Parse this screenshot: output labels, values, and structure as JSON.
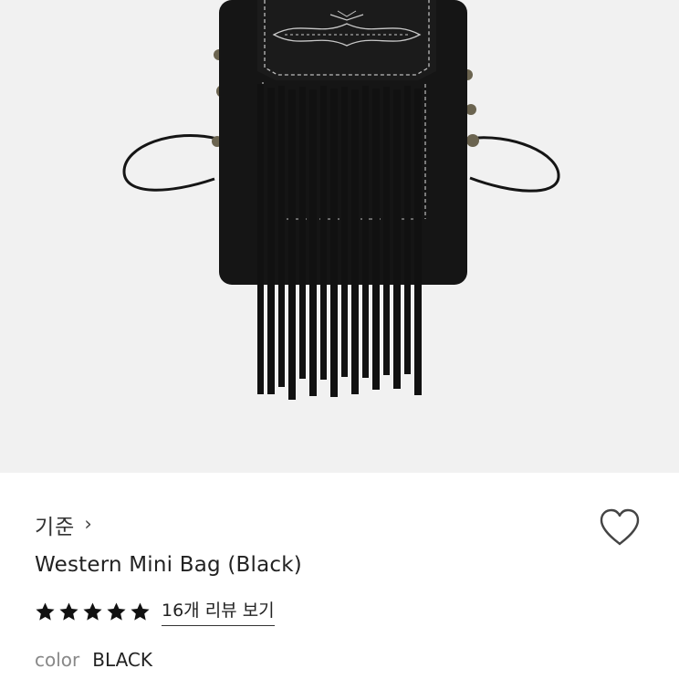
{
  "product": {
    "brand": "기준",
    "title": "Western Mini Bag (Black)",
    "rating_stars": 5,
    "review_link": "16개 리뷰 보기",
    "option_label": "color",
    "option_value": "BLACK"
  },
  "colors": {
    "image_bg": "#f1f1f1",
    "bag": "#141414",
    "stitch": "#bdbdbd",
    "star": "#111111",
    "heart_outline": "#444444"
  },
  "icons": {
    "brand_chevron": "chevron-right-icon",
    "wish": "heart-outline-icon",
    "rating": "star-icon"
  }
}
